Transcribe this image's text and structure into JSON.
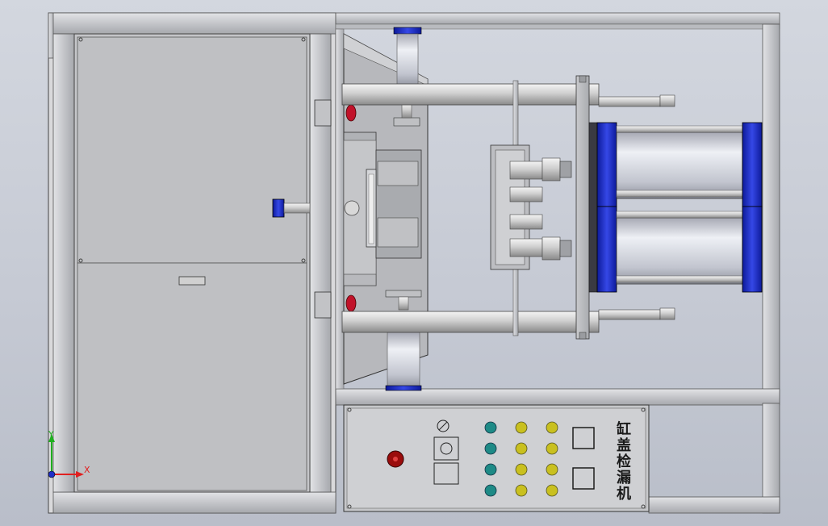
{
  "panel": {
    "label": "缸盖检漏机",
    "indicator_rows": [
      {
        "colors": [
          "teal",
          "yellow",
          "yellow"
        ]
      },
      {
        "colors": [
          "teal",
          "yellow",
          "yellow"
        ]
      },
      {
        "colors": [
          "teal",
          "yellow",
          "yellow"
        ]
      },
      {
        "colors": [
          "teal",
          "yellow",
          "yellow"
        ]
      }
    ]
  },
  "triad": {
    "x_label": "X",
    "y_label": "Y"
  },
  "colors": {
    "background": "#c6cad4",
    "frame": "#d0d2d6",
    "cylinder_blue": "#1f2fc8",
    "indicator_teal": "#1e8a86",
    "indicator_yellow": "#c9c01f",
    "emergency_red": "#b01818",
    "axis_x": "#e02020",
    "axis_y": "#20b020"
  }
}
